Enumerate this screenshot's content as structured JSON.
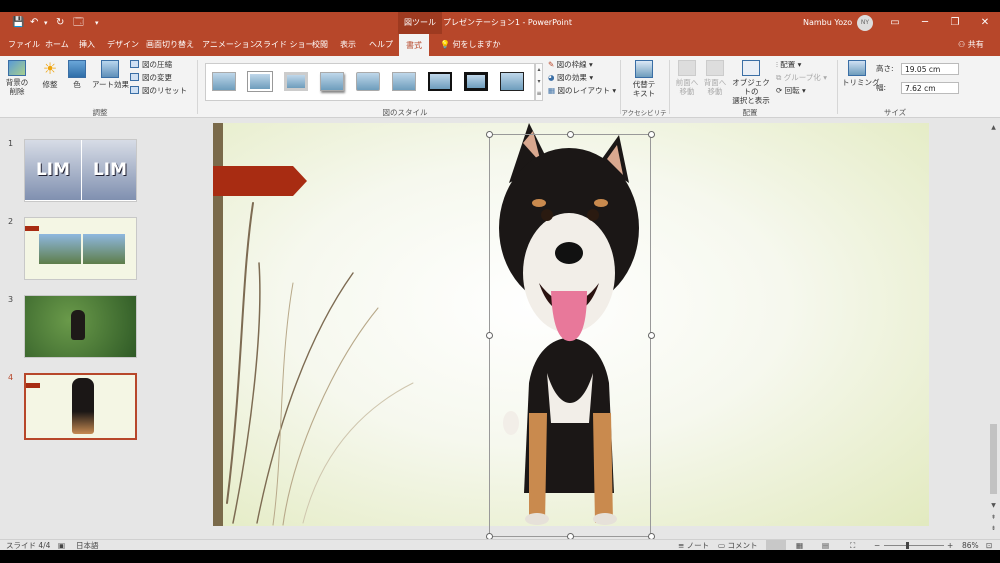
{
  "titlebar": {
    "context_tab": "図ツール",
    "title": "プレゼンテーション1 - PowerPoint",
    "user_name": "Nambu Yozo",
    "user_initials": "NY",
    "minimize": "─",
    "restore": "❐",
    "close": "✕",
    "ribbon_display": "▭"
  },
  "quick_access": {
    "save": "💾",
    "undo": "↶",
    "redo": "↻",
    "start": "🗔",
    "customize": "▾"
  },
  "tabs": [
    "ファイル",
    "ホーム",
    "挿入",
    "デザイン",
    "画面切り替え",
    "アニメーション",
    "スライド ショー",
    "校閲",
    "表示",
    "ヘルプ",
    "書式"
  ],
  "active_tab": "書式",
  "tell_me": "何をしますか",
  "share": "共有",
  "ribbon": {
    "adjust": {
      "remove_bg": "背景の\n削除",
      "corrections": "修整",
      "color": "色",
      "artistic": "アート効果",
      "compress": "図の圧縮",
      "change": "図の変更",
      "reset": "図のリセット",
      "label": "調整"
    },
    "styles": {
      "label": "図のスタイル",
      "border": "図の枠線",
      "effects": "図の効果",
      "layout": "図のレイアウト"
    },
    "accessibility": {
      "alt_text": "代替テ\nキスト",
      "label": "アクセシビリティ"
    },
    "arrange": {
      "forward": "前面へ\n移動",
      "backward": "背面へ\n移動",
      "selection_pane": "オブジェクトの\n選択と表示",
      "align": "配置",
      "group": "グループ化",
      "rotate": "回転",
      "label": "配置"
    },
    "size": {
      "crop": "トリミング",
      "height_label": "高さ:",
      "height_value": "19.05 cm",
      "width_label": "幅:",
      "width_value": "7.62 cm",
      "label": "サイズ"
    }
  },
  "slides": [
    {
      "number": "1",
      "text": "LIM LIM"
    },
    {
      "number": "2"
    },
    {
      "number": "3"
    },
    {
      "number": "4"
    }
  ],
  "selected_slide": 4,
  "statusbar": {
    "slide_info": "スライド 4/4",
    "language": "日本語",
    "notes": "ノート",
    "comments": "コメント",
    "zoom": "86%",
    "zoom_minus": "−",
    "zoom_plus": "+"
  },
  "colors": {
    "accent": "#b7472a",
    "ribbon_bg": "#f3f3f3",
    "slide_bar": "#7a6a4a",
    "banner": "#a82c12"
  }
}
